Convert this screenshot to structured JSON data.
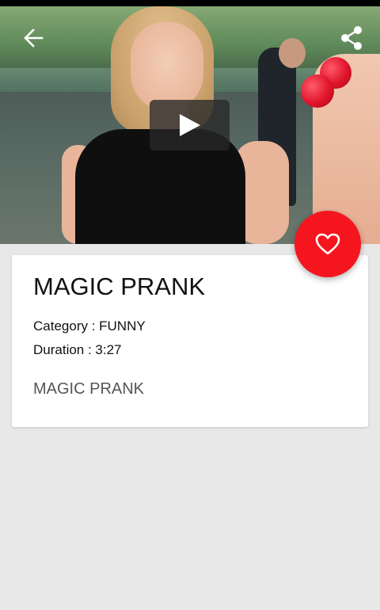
{
  "header": {
    "back_icon": "arrow-left-icon",
    "share_icon": "share-icon"
  },
  "video": {
    "play_icon": "play-icon"
  },
  "card": {
    "title": "MAGIC PRANK",
    "category": "Category : FUNNY",
    "duration": "Duration : 3:27",
    "description": "MAGIC PRANK"
  },
  "favorite": {
    "icon": "heart-outline-icon"
  },
  "colors": {
    "accent": "#f5151f",
    "background": "#e8e8e8",
    "card": "#ffffff"
  }
}
